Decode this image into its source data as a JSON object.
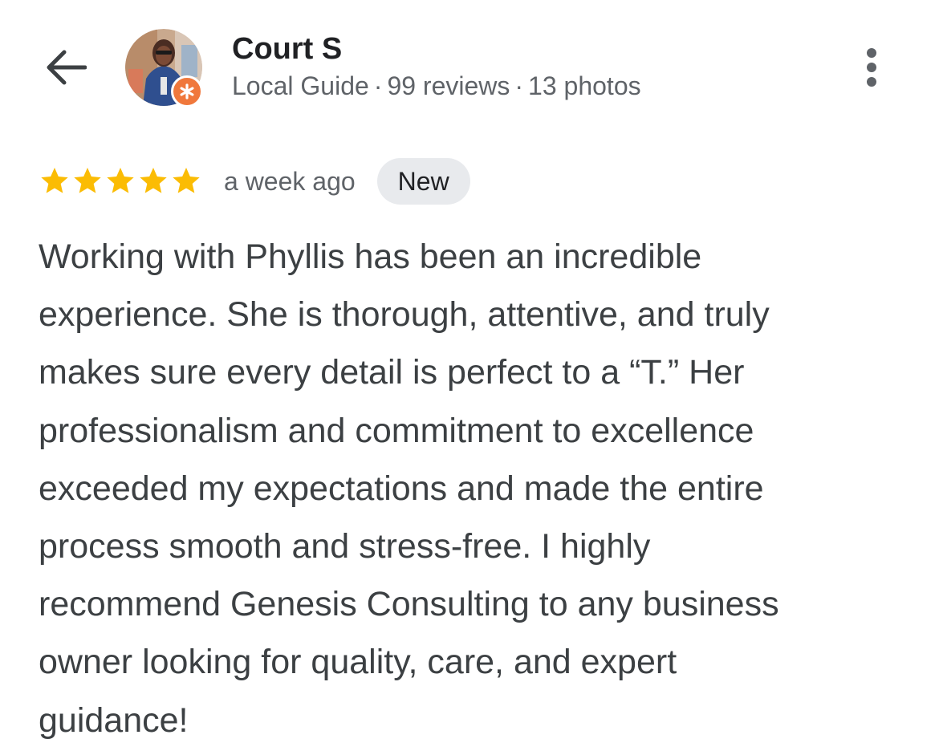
{
  "header": {
    "back_icon": "arrow-back-icon",
    "reviewer": {
      "name": "Court S",
      "role": "Local Guide",
      "reviews": "99 reviews",
      "photos": "13 photos",
      "separator": "·",
      "avatar_icon": "user-avatar",
      "badge_icon": "local-guide-star-icon"
    },
    "more_icon": "more-vert-icon"
  },
  "review": {
    "rating": 5,
    "rating_max": 5,
    "star_color": "#fbbc04",
    "time_ago": "a week ago",
    "badge": "New",
    "text": "Working with Phyllis has been an incredible\nexperience. She is thorough, attentive, and truly\nmakes sure every detail is perfect to a “T.” Her\nprofessionalism and commitment to excellence\nexceeded my expectations and made the entire\nprocess smooth and stress-free. I highly\nrecommend Genesis Consulting to any business\nowner looking for quality, care, and expert\nguidance!"
  },
  "colors": {
    "text_primary": "#202124",
    "text_body": "#3c4043",
    "text_secondary": "#5f6368",
    "badge_bg": "#e8eaed",
    "guide_badge": "#f0783c"
  }
}
